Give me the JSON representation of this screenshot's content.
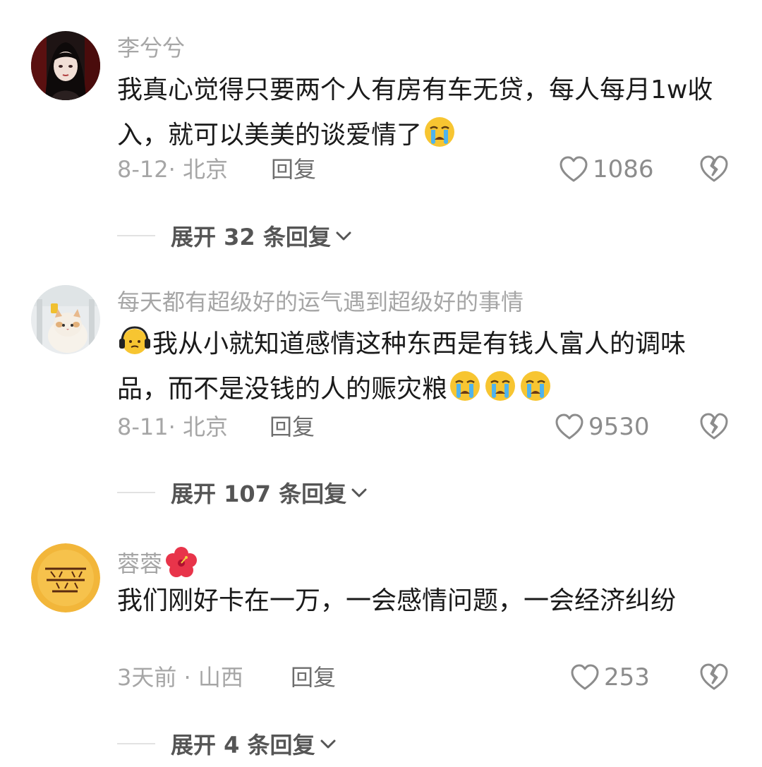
{
  "comments": [
    {
      "username": "李兮兮",
      "text": "我真心觉得只要两个人有房有车无贷，每人每月1w收入，就可以美美的谈爱情了",
      "text_emojis": [
        "crying-face"
      ],
      "date": "8-12",
      "location": "北京",
      "reply_label": "回复",
      "likes": "1086",
      "expand_label": "展开 32 条回复"
    },
    {
      "username": "每天都有超级好的运气遇到超级好的事情",
      "text_pre_emojis": [
        "headphones-face"
      ],
      "text": "我从小就知道感情这种东西是有钱人富人的调味品，而不是没钱的人的赈灾粮",
      "text_emojis": [
        "crying-face",
        "crying-face",
        "crying-face"
      ],
      "date": "8-11",
      "location": "北京",
      "reply_label": "回复",
      "likes": "9530",
      "expand_label": "展开 107 条回复"
    },
    {
      "username": "蓉蓉",
      "username_emoji": "hibiscus-flower",
      "text": "我们刚好卡在一万，一会感情问题，一会经济纠纷",
      "date": "3天前",
      "location": "山西",
      "reply_label": "回复",
      "likes": "253",
      "expand_label": "展开 4 条回复"
    }
  ],
  "separator": "·",
  "colors": {
    "username": "#a6a6a6",
    "text": "#1a1a1a",
    "meta": "#a6a6a6",
    "reply": "#6e6e6e",
    "expand": "#555555"
  }
}
